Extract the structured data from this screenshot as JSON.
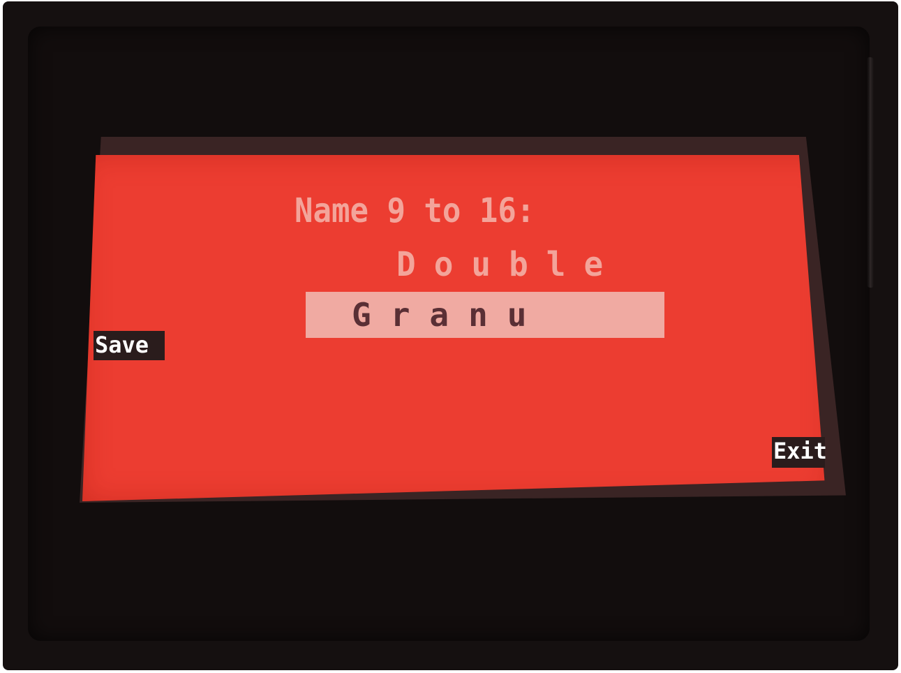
{
  "screen": {
    "title": "Name 9 to 16:",
    "name_line": "Double",
    "edit_value": "Granu"
  },
  "softkeys": {
    "save_label": "Save",
    "exit_label": "Exit"
  },
  "colors": {
    "lcd_background": "#ec3d31",
    "lcd_text": "#f3a49a",
    "edit_highlight": "#f0aaa2",
    "edit_text": "#5a2f35",
    "softkey_background": "#2a1c1c",
    "softkey_text": "#ffffff"
  }
}
